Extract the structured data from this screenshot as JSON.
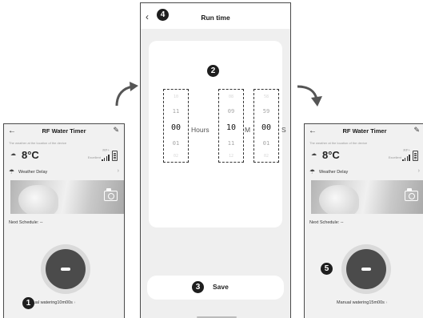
{
  "left_screen": {
    "title": "RF Water Timer",
    "weather_note": "The weather at the location of the device",
    "temperature": "8°C",
    "rf_label": "RF+",
    "signal_label": "Excellent",
    "weather_delay_label": "Weather Delay",
    "next_schedule_label": "Next Schedule: --",
    "manual_watering": "Manual watering10m00s",
    "badge": "1"
  },
  "middle_screen": {
    "title": "Run time",
    "badge_title": "4",
    "badge_picker": "2",
    "hours": {
      "prev2": "10",
      "prev1": "11",
      "selected": "00",
      "next1": "01",
      "next2": "02",
      "unit": "Hours"
    },
    "minutes": {
      "prev2": "08",
      "prev1": "09",
      "selected": "10",
      "next1": "11",
      "next2": "12",
      "unit": "M"
    },
    "seconds": {
      "prev2": "58",
      "prev1": "59",
      "selected": "00",
      "next1": "01",
      "next2": "02",
      "unit": "S"
    },
    "save_label": "Save",
    "badge_save": "3"
  },
  "right_screen": {
    "title": "RF Water Timer",
    "weather_note": "The weather at the location of the device",
    "temperature": "8°C",
    "rf_label": "RF+",
    "signal_label": "Excellent",
    "weather_delay_label": "Weather Delay",
    "next_schedule_label": "Next Schedule: --",
    "manual_watering": "Manual watering15m00s",
    "badge": "5"
  }
}
